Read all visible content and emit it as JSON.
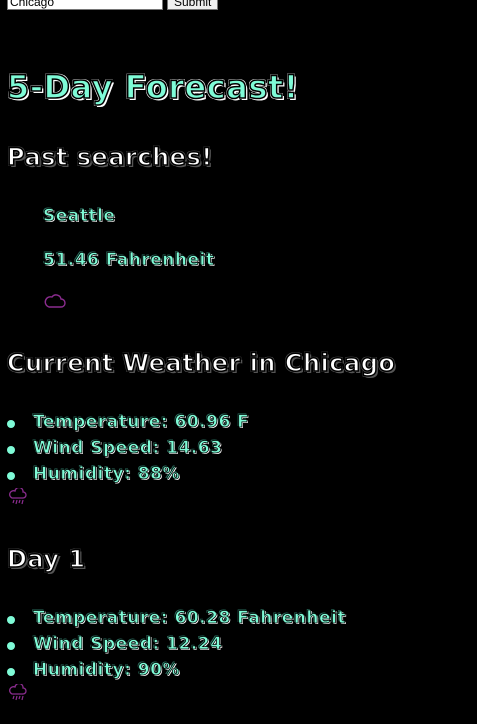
{
  "search": {
    "value": "Chicago",
    "submit_label": "Submit"
  },
  "page": {
    "title": "5-Day Forecast!"
  },
  "past": {
    "heading": "Past searches!",
    "city": "Seattle",
    "temperature": "51.46 Fahrenheit",
    "icon": "cloud-icon"
  },
  "current": {
    "heading": "Current Weather in Chicago",
    "items": [
      "Temperature: 60.96 F",
      "Wind Speed: 14.63",
      "Humidity: 88%"
    ],
    "icon": "rain-cloud-icon"
  },
  "day1": {
    "heading": "Day 1",
    "items": [
      "Temperature: 60.28 Fahrenheit",
      "Wind Speed: 12.24",
      "Humidity: 90%"
    ],
    "icon": "rain-cloud-icon"
  },
  "colors": {
    "background": "#000000",
    "accent": "#7ffbd7",
    "icon": "#8b2c8f"
  }
}
